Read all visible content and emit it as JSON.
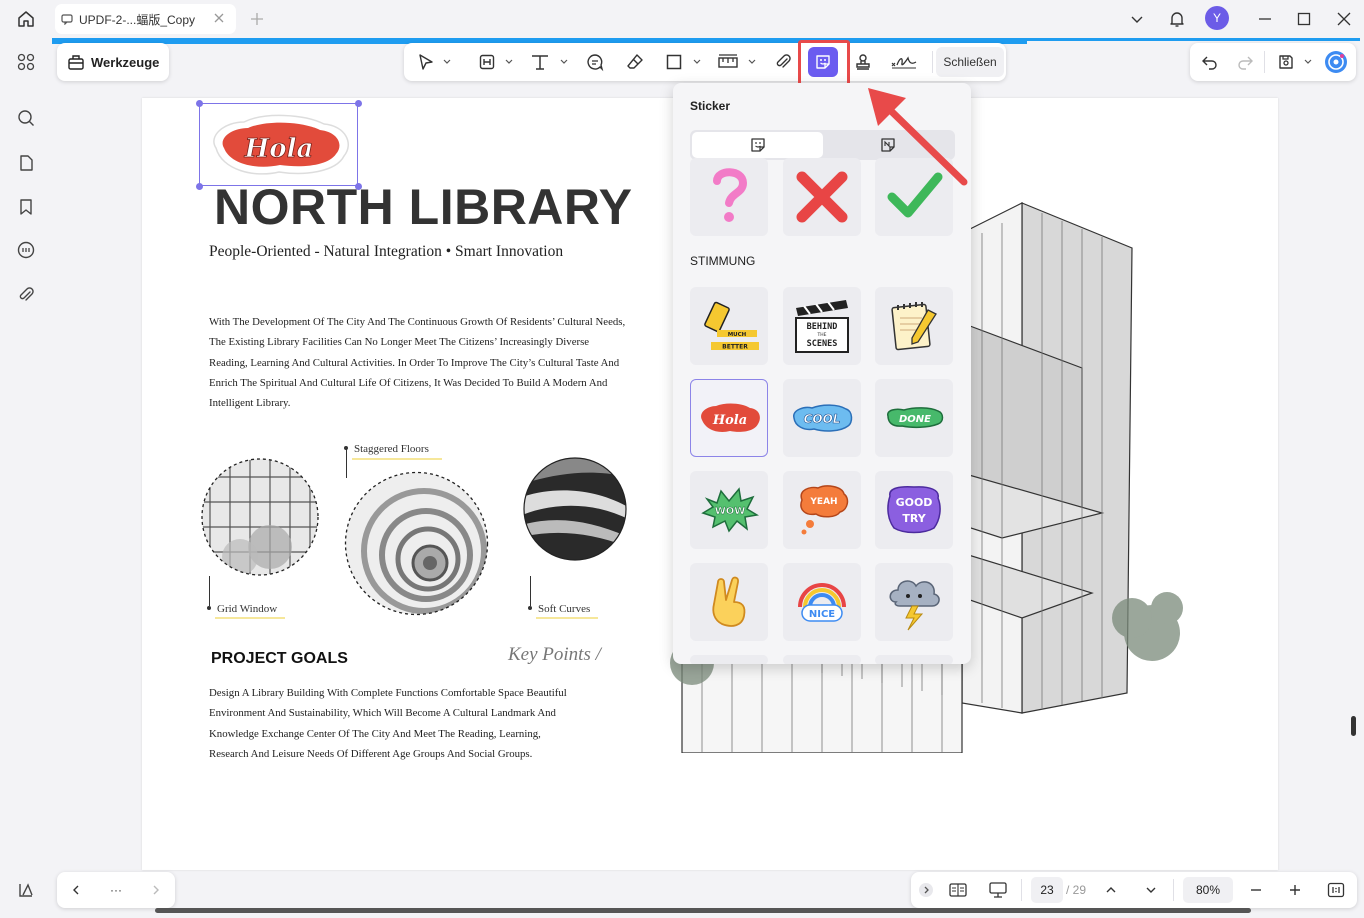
{
  "titlebar": {
    "tab_title": "UPDF-2-...蝠版_Copy",
    "avatar_initial": "Y"
  },
  "toolbar": {
    "tools_label": "Werkzeuge",
    "close_label": "Schließen"
  },
  "sticker_panel": {
    "title": "Sticker",
    "category": "STIMMUNG"
  },
  "document": {
    "title": "NORTH LIBRARY",
    "subtitle": "People-Oriented - Natural Integration • Smart Innovation",
    "intro": "With The Development Of The City And The Continuous Growth Of Residents’ Cultural Needs, The Existing Library Facilities Can No Longer Meet The Citizens’ Increasingly Diverse Reading, Learning And Cultural Activities. In Order To Improve The City’s Cultural Taste And Enrich The Spiritual And Cultural Life Of Citizens, It Was Decided To Build A Modern And Intelligent Library.",
    "caption_staggered": "Staggered Floors",
    "caption_grid": "Grid Window",
    "caption_curves": "Soft Curves",
    "section_heading": "PROJECT GOALS",
    "key_points": "Key Points /",
    "goals_text": "Design A Library Building With Complete Functions Comfortable Space Beautiful Environment And Sustainability, Which Will Become A Cultural Landmark And Knowledge Exchange Center Of The City And Meet The Reading, Learning, Research And Leisure Needs Of Different Age Groups And Social Groups.",
    "selected_sticker_text": "Hola"
  },
  "pager": {
    "ellipsis": "···",
    "current_page": "23",
    "total_pages": "/ 29",
    "zoom": "80%"
  },
  "stickers": {
    "s_better_line1": "MUCH",
    "s_better_line2": "BETTER",
    "s_behind_1": "BEHIND",
    "s_behind_2": "THE",
    "s_behind_3": "SCENES",
    "s_hola": "Hola",
    "s_cool": "COOL",
    "s_done": "DONE",
    "s_wow": "WOW",
    "s_yeah": "YEAH",
    "s_good": "GOOD",
    "s_try": "TRY",
    "s_nice": "NICE"
  },
  "colors": {
    "accent": "#6b5cf0",
    "highlight_red": "#e84a4a",
    "top_strip": "#1e9cf0"
  }
}
